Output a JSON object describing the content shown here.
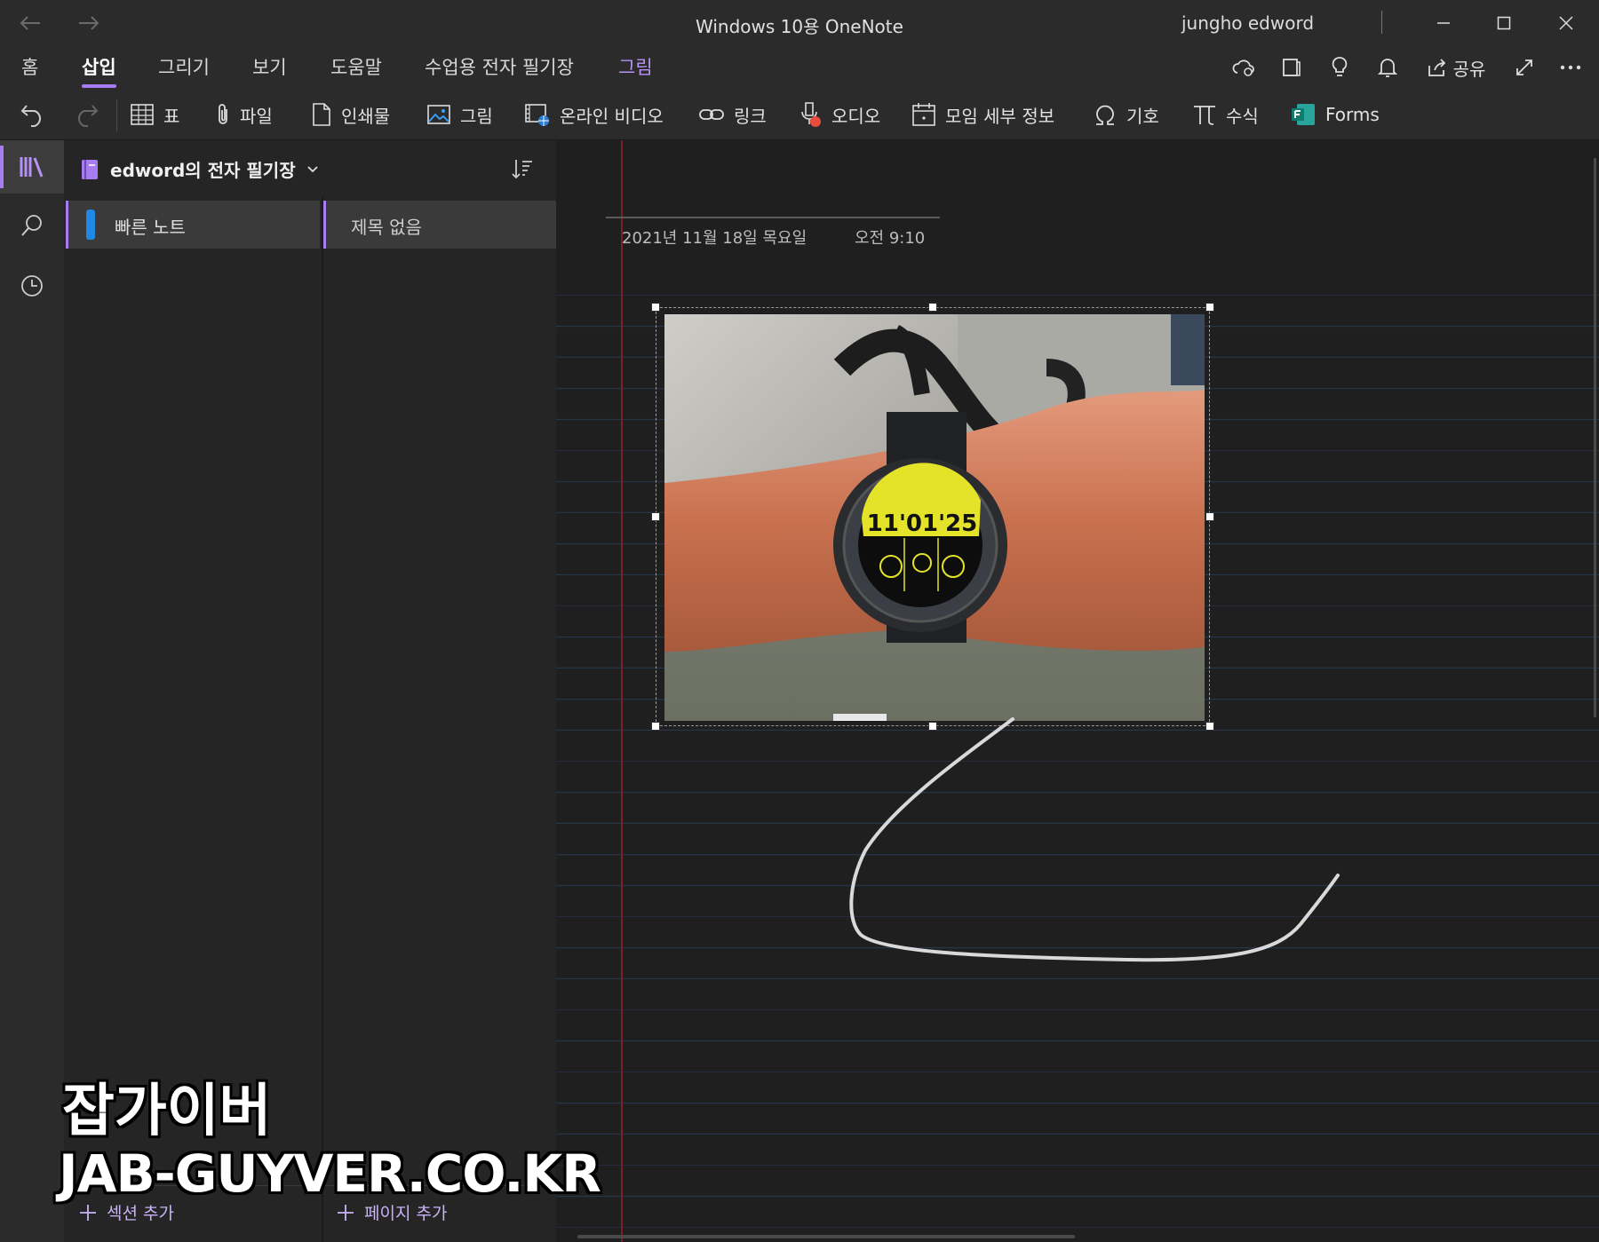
{
  "window": {
    "title": "Windows 10용 OneNote",
    "user": "jungho edword"
  },
  "ribbon": {
    "tabs": [
      {
        "label": "홈"
      },
      {
        "label": "삽입"
      },
      {
        "label": "그리기"
      },
      {
        "label": "보기"
      },
      {
        "label": "도움말"
      },
      {
        "label": "수업용 전자 필기장"
      },
      {
        "label": "그림"
      }
    ],
    "active_tab": "삽입",
    "share_label": "공유",
    "insert_items": [
      {
        "label": "표",
        "icon": "table-icon"
      },
      {
        "label": "파일",
        "icon": "paperclip-icon"
      },
      {
        "label": "인쇄물",
        "icon": "page-icon"
      },
      {
        "label": "그림",
        "icon": "picture-icon"
      },
      {
        "label": "온라인 비디오",
        "icon": "online-video-icon"
      },
      {
        "label": "링크",
        "icon": "link-icon"
      },
      {
        "label": "오디오",
        "icon": "audio-icon"
      },
      {
        "label": "모임 세부 정보",
        "icon": "calendar-icon"
      },
      {
        "label": "기호",
        "icon": "omega-icon"
      },
      {
        "label": "수식",
        "icon": "pi-icon"
      },
      {
        "label": "Forms",
        "icon": "forms-icon"
      }
    ]
  },
  "notebook": {
    "name": "edword의 전자 필기장",
    "sections": [
      {
        "label": "빠른 노트",
        "color": "#1e88e5"
      }
    ],
    "pages": [
      {
        "label": "제목 없음"
      }
    ],
    "add_section_label": "섹션 추가",
    "add_page_label": "페이지 추가"
  },
  "page": {
    "date": "2021년 11월 18일 목요일",
    "time": "오전 9:10",
    "image_alt": "wrist wearing a smartwatch showing 11'01'25"
  },
  "photo_text": {
    "watch_time": "11'01'25"
  },
  "watermark": {
    "line1": "잡가이버",
    "line2": "JAB-GUYVER.CO.KR"
  },
  "colors": {
    "accent": "#a67cf0",
    "section_tab": "#1e88e5",
    "background": "#1f1f1f",
    "chrome": "#2b2b2b"
  }
}
